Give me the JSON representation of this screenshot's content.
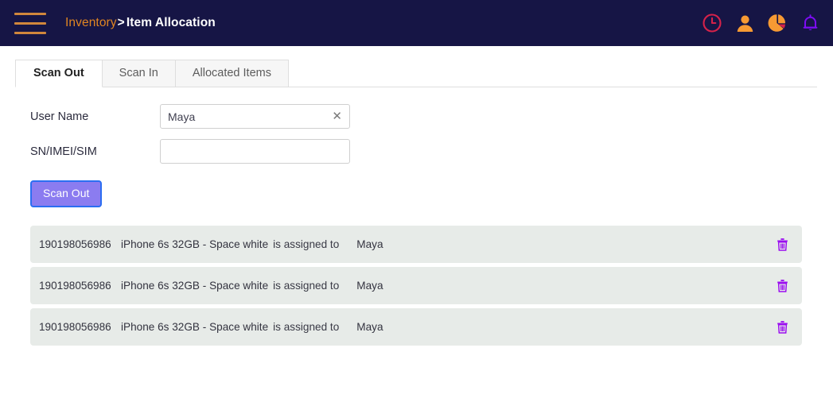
{
  "header": {
    "menu_icon": "hamburger-menu-icon",
    "breadcrumb": {
      "parent": "Inventory",
      "separator": ">",
      "current": "Item Allocation"
    },
    "icons": [
      {
        "name": "clock-icon",
        "color": "#d6224a"
      },
      {
        "name": "user-icon",
        "color": "#f79a33"
      },
      {
        "name": "pie-chart-icon",
        "color": "#f79a33",
        "accent": "#d6224a"
      },
      {
        "name": "bell-icon",
        "color": "#7d0cf5"
      }
    ],
    "background": "#161545"
  },
  "tabs": [
    {
      "label": "Scan Out",
      "active": true
    },
    {
      "label": "Scan In",
      "active": false
    },
    {
      "label": "Allocated Items",
      "active": false
    }
  ],
  "form": {
    "username": {
      "label": "User Name",
      "value": "Maya",
      "placeholder": "",
      "clear_icon": "clear-x-icon"
    },
    "serial": {
      "label": "SN/IMEI/SIM",
      "value": "",
      "placeholder": ""
    },
    "submit_label": "Scan Out",
    "submit_color": "#8b7cf0"
  },
  "results": {
    "assigned_text": "is assigned to",
    "delete_icon": "trash-icon",
    "delete_icon_color": "#9b0df0",
    "row_background": "#e7ebe8",
    "rows": [
      {
        "serial": "190198056986",
        "item": "iPhone 6s 32GB - Space white",
        "assigned": "is assigned to",
        "user": "Maya"
      },
      {
        "serial": "190198056986",
        "item": "iPhone 6s 32GB - Space white",
        "assigned": "is assigned to",
        "user": "Maya"
      },
      {
        "serial": "190198056986",
        "item": "iPhone 6s 32GB - Space white",
        "assigned": "is assigned to",
        "user": "Maya"
      }
    ]
  }
}
